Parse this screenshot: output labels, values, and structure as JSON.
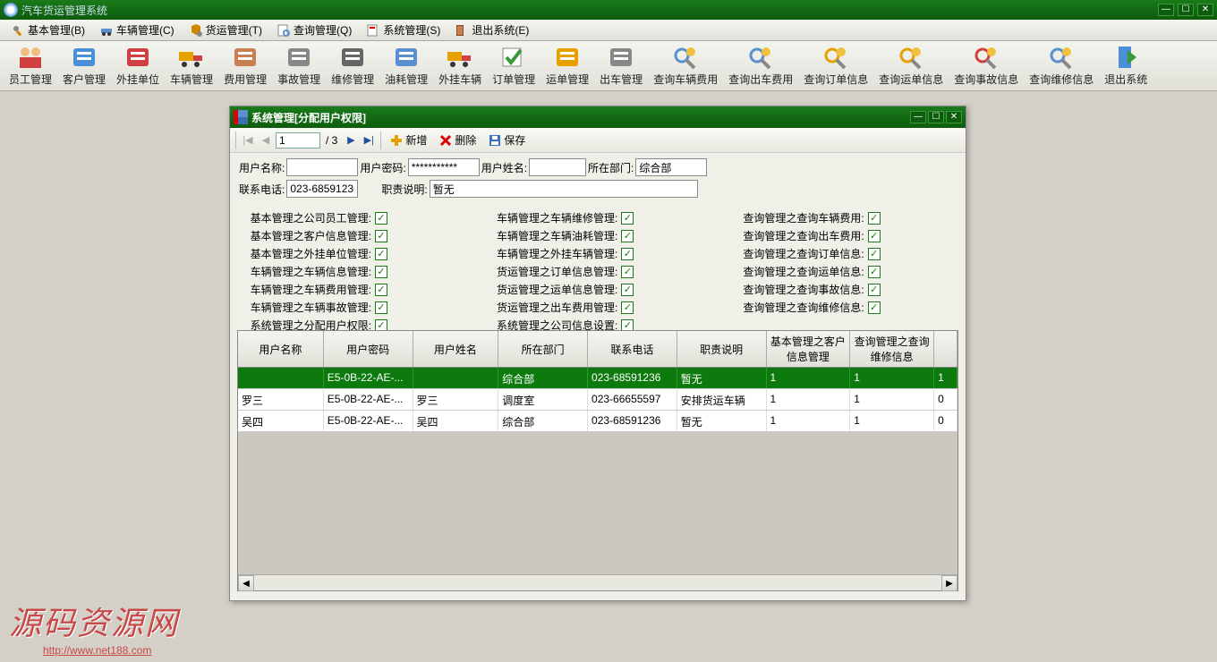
{
  "app": {
    "title": "汽车货运管理系统"
  },
  "menubar": [
    {
      "icon": "tools",
      "label": "基本管理(B)"
    },
    {
      "icon": "car",
      "label": "车辆管理(C)"
    },
    {
      "icon": "freight",
      "label": "货运管理(T)"
    },
    {
      "icon": "search",
      "label": "查询管理(Q)"
    },
    {
      "icon": "system",
      "label": "系统管理(S)"
    },
    {
      "icon": "exit",
      "label": "退出系统(E)"
    }
  ],
  "toolbar": [
    {
      "label": "员工管理",
      "icon": "users"
    },
    {
      "label": "客户管理",
      "icon": "globe"
    },
    {
      "label": "外挂单位",
      "icon": "house"
    },
    {
      "label": "车辆管理",
      "icon": "truck"
    },
    {
      "label": "费用管理",
      "icon": "book"
    },
    {
      "label": "事故管理",
      "icon": "calc"
    },
    {
      "label": "维修管理",
      "icon": "wrench"
    },
    {
      "label": "油耗管理",
      "icon": "form"
    },
    {
      "label": "外挂车辆",
      "icon": "truck2"
    },
    {
      "label": "订单管理",
      "icon": "check"
    },
    {
      "label": "运单管理",
      "icon": "mail"
    },
    {
      "label": "出车管理",
      "icon": "gear"
    },
    {
      "label": "查询车辆费用",
      "icon": "find"
    },
    {
      "label": "查询出车费用",
      "icon": "find2"
    },
    {
      "label": "查询订单信息",
      "icon": "find3"
    },
    {
      "label": "查询运单信息",
      "icon": "find4"
    },
    {
      "label": "查询事故信息",
      "icon": "find5"
    },
    {
      "label": "查询维修信息",
      "icon": "find6"
    },
    {
      "label": "退出系统",
      "icon": "door"
    }
  ],
  "dialog": {
    "title": "系统管理[分配用户权限]",
    "nav": {
      "page": "1",
      "total": "/ 3",
      "add": "新增",
      "del": "删除",
      "save": "保存"
    },
    "form": {
      "labels": {
        "username": "用户名称:",
        "password": "用户密码:",
        "realname": "用户姓名:",
        "dept": "所在部门:",
        "phone": "联系电话:",
        "duty": "职责说明:"
      },
      "values": {
        "username": "",
        "password": "***********",
        "realname": "",
        "dept": "综合部",
        "phone": "023-68591236",
        "duty": "暂无"
      }
    },
    "permissions": {
      "col1": [
        "基本管理之公司员工管理:",
        "基本管理之客户信息管理:",
        "基本管理之外挂单位管理:",
        "车辆管理之车辆信息管理:",
        "车辆管理之车辆费用管理:",
        "车辆管理之车辆事故管理:",
        "系统管理之分配用户权限:"
      ],
      "col2": [
        "车辆管理之车辆维修管理:",
        "车辆管理之车辆油耗管理:",
        "车辆管理之外挂车辆管理:",
        "货运管理之订单信息管理:",
        "货运管理之运单信息管理:",
        "货运管理之出车费用管理:",
        "系统管理之公司信息设置:"
      ],
      "col3": [
        "查询管理之查询车辆费用:",
        "查询管理之查询出车费用:",
        "查询管理之查询订单信息:",
        "查询管理之查询运单信息:",
        "查询管理之查询事故信息:",
        "查询管理之查询维修信息:"
      ]
    },
    "grid": {
      "headers": [
        "用户名称",
        "用户密码",
        "用户姓名",
        "所在部门",
        "联系电话",
        "职责说明",
        "基本管理之客户信息管理",
        "查询管理之查询维修信息",
        ""
      ],
      "rows": [
        {
          "selected": true,
          "cells": [
            "",
            "E5-0B-22-AE-...",
            "",
            "综合部",
            "023-68591236",
            "暂无",
            "1",
            "1",
            "1"
          ]
        },
        {
          "selected": false,
          "cells": [
            "罗三",
            "E5-0B-22-AE-...",
            "罗三",
            "调度室",
            "023-66655597",
            "安排货运车辆",
            "1",
            "1",
            "0"
          ]
        },
        {
          "selected": false,
          "cells": [
            "吴四",
            "E5-0B-22-AE-...",
            "吴四",
            "综合部",
            "023-68591236",
            "暂无",
            "1",
            "1",
            "0"
          ]
        }
      ]
    }
  },
  "watermark": {
    "text": "源码资源网",
    "url": "http://www.net188.com"
  }
}
